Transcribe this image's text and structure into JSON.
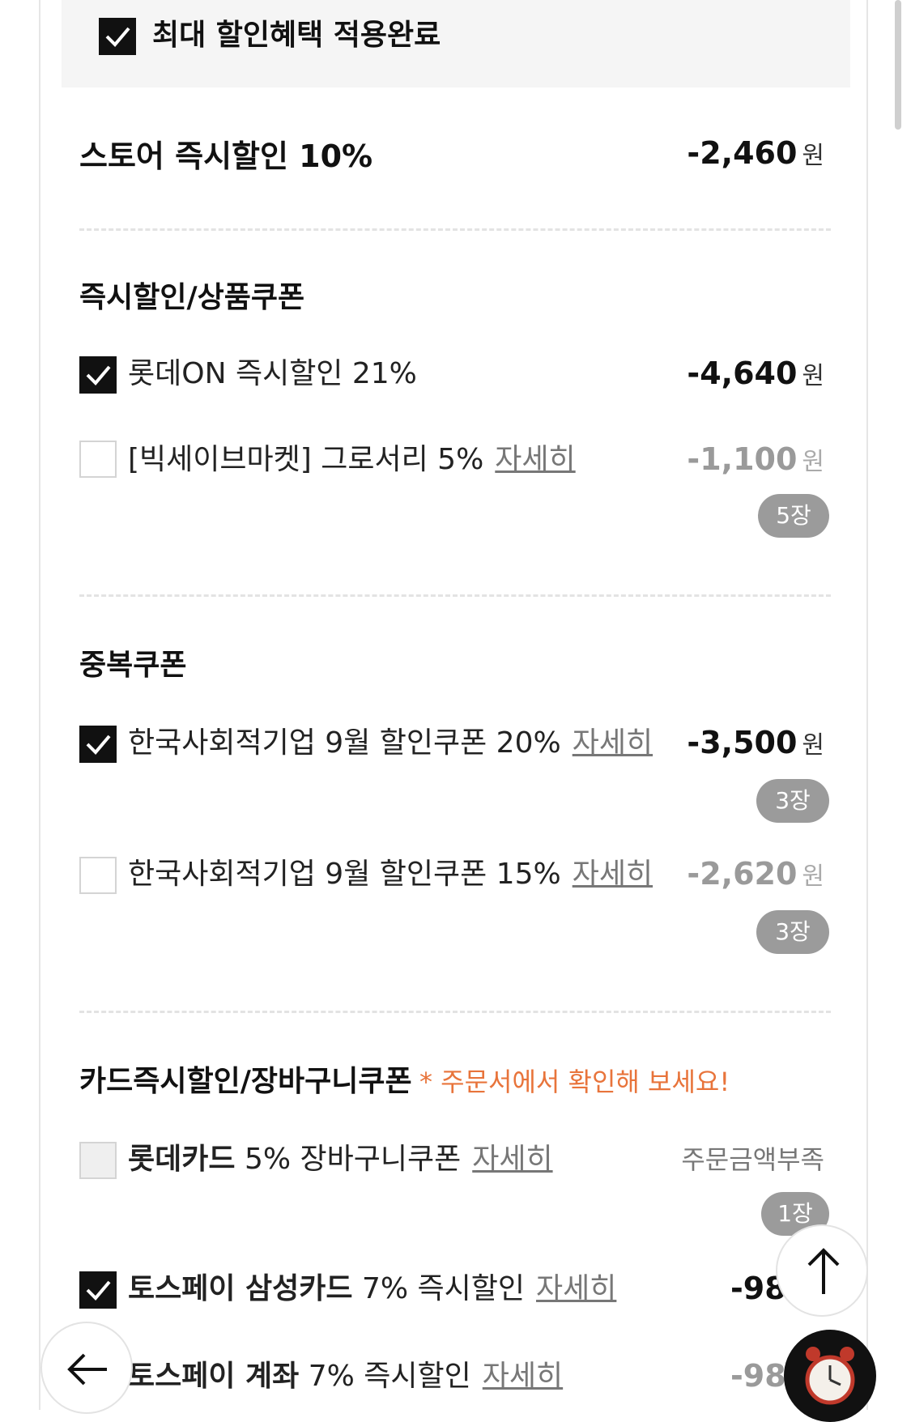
{
  "banner": {
    "label": "최대 할인혜택 적용완료",
    "checked": true
  },
  "store_discount": {
    "label": "스토어 즉시할인 10%",
    "amount": "-2,460",
    "unit": "원"
  },
  "instant_section": {
    "title": "즉시할인/상품쿠폰",
    "items": [
      {
        "name": "롯데ON 즉시할인 21%",
        "amount": "-4,640",
        "unit": "원",
        "checked": true
      },
      {
        "name": "[빅세이브마켓] 그로서리 5%",
        "link": "자세히",
        "amount": "-1,100",
        "unit": "원",
        "count": "5장",
        "checked": false
      }
    ]
  },
  "duplicate_section": {
    "title": "중복쿠폰",
    "items": [
      {
        "name": "한국사회적기업 9월 할인쿠폰 20%",
        "link": "자세히",
        "amount": "-3,500",
        "unit": "원",
        "count": "3장",
        "checked": true
      },
      {
        "name": "한국사회적기업 9월 할인쿠폰 15%",
        "link": "자세히",
        "amount": "-2,620",
        "unit": "원",
        "count": "3장",
        "checked": false
      }
    ]
  },
  "card_section": {
    "title": "카드즉시할인/장바구니쿠폰",
    "note": "* 주문서에서 확인해 보세요!",
    "items": [
      {
        "brand": "롯데카드",
        "desc": "5% 장바구니쿠폰",
        "link": "자세히",
        "status": "주문금액부족",
        "count": "1장",
        "checked": false
      },
      {
        "brand": "토스페이 삼성카드",
        "desc": "7% 즉시할인",
        "link": "자세히",
        "amount": "-98",
        "checked": true
      },
      {
        "brand": "토스페이 계좌",
        "desc": "7% 즉시할인",
        "link": "자세히",
        "amount": "-98",
        "checked": false
      }
    ]
  },
  "fabs": {
    "scroll_top": "arrow-up-icon",
    "back": "arrow-left-icon",
    "alarm": "alarm-clock-icon"
  },
  "colors": {
    "accent_note": "#e8743b",
    "checked": "#111111",
    "pill": "#9b9b9b"
  }
}
